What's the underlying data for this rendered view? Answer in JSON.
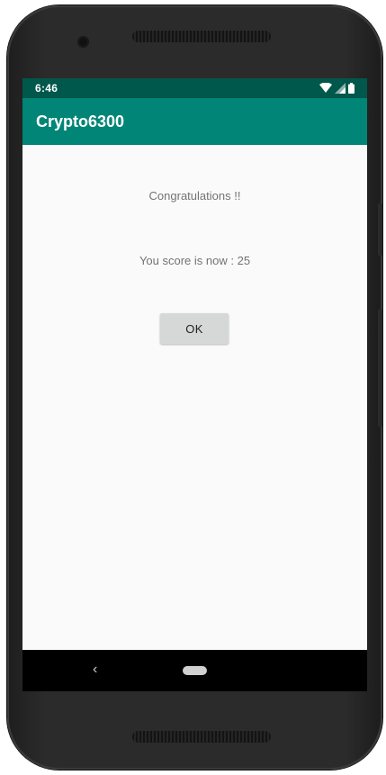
{
  "status_bar": {
    "time": "6:46",
    "icons": [
      "wifi-icon",
      "cell-signal-icon",
      "battery-icon"
    ]
  },
  "app_bar": {
    "title": "Crypto6300"
  },
  "dialog": {
    "message": "Congratulations !!",
    "score_text": "You score is now : 25",
    "ok_label": "OK"
  },
  "nav_bar": {
    "icons": [
      "back-icon",
      "home-icon"
    ]
  },
  "colors": {
    "status_bar": "#00574b",
    "app_bar": "#008577",
    "screen_background": "#fafafa",
    "button": "#d6d7d7"
  }
}
